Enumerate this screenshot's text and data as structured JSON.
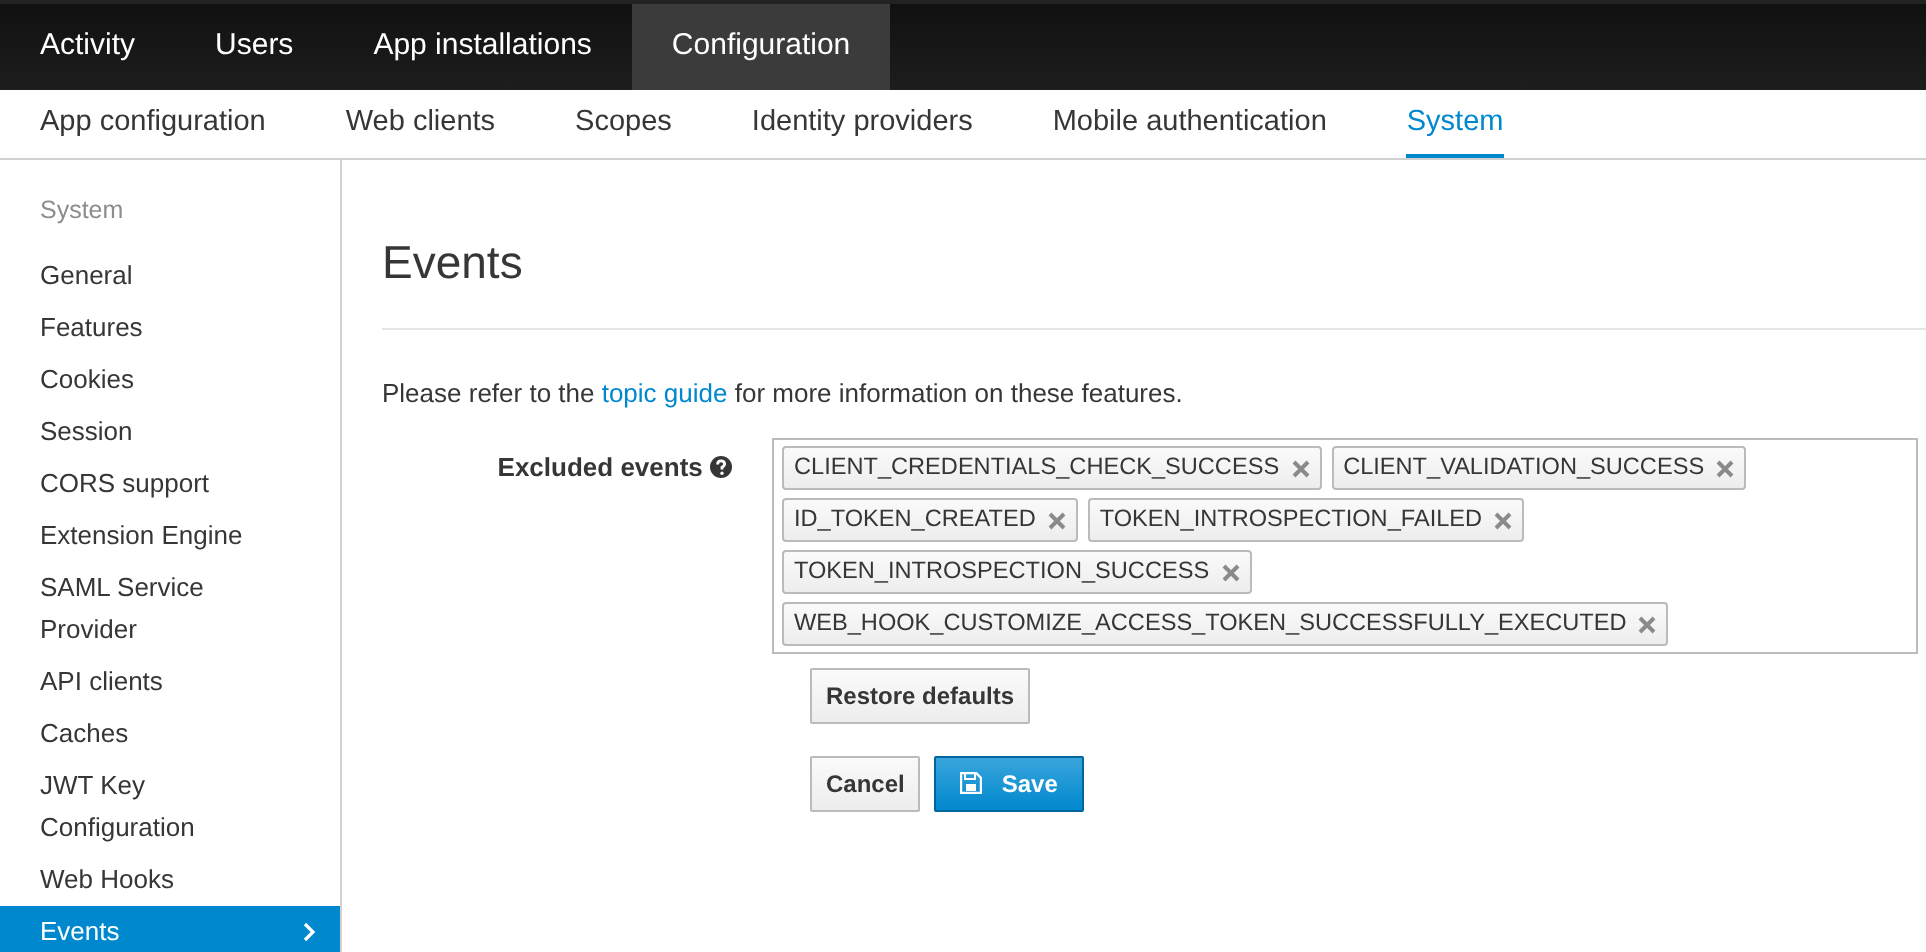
{
  "top_nav": [
    {
      "label": "Activity",
      "selected": false
    },
    {
      "label": "Users",
      "selected": false
    },
    {
      "label": "App installations",
      "selected": false
    },
    {
      "label": "Configuration",
      "selected": true
    }
  ],
  "sub_nav": [
    {
      "label": "App configuration",
      "selected": false
    },
    {
      "label": "Web clients",
      "selected": false
    },
    {
      "label": "Scopes",
      "selected": false
    },
    {
      "label": "Identity providers",
      "selected": false
    },
    {
      "label": "Mobile authentication",
      "selected": false
    },
    {
      "label": "System",
      "selected": true
    }
  ],
  "sidebar": {
    "heading": "System",
    "items": [
      {
        "label": "General",
        "selected": false
      },
      {
        "label": "Features",
        "selected": false
      },
      {
        "label": "Cookies",
        "selected": false
      },
      {
        "label": "Session",
        "selected": false
      },
      {
        "label": "CORS support",
        "selected": false
      },
      {
        "label": "Extension Engine",
        "selected": false
      },
      {
        "label": "SAML Service Provider",
        "selected": false
      },
      {
        "label": "API clients",
        "selected": false
      },
      {
        "label": "Caches",
        "selected": false
      },
      {
        "label": "JWT Key Configuration",
        "selected": false
      },
      {
        "label": "Web Hooks",
        "selected": false
      },
      {
        "label": "Events",
        "selected": true
      }
    ]
  },
  "page_title": "Events",
  "intro": {
    "before": "Please refer to the ",
    "link": "topic guide",
    "after": " for more information on these features."
  },
  "excluded_events": {
    "label": "Excluded events",
    "tags": [
      "CLIENT_CREDENTIALS_CHECK_SUCCESS",
      "CLIENT_VALIDATION_SUCCESS",
      "ID_TOKEN_CREATED",
      "TOKEN_INTROSPECTION_FAILED",
      "TOKEN_INTROSPECTION_SUCCESS",
      "WEB_HOOK_CUSTOMIZE_ACCESS_TOKEN_SUCCESSFULLY_EXECUTED"
    ]
  },
  "restore_button": "Restore defaults",
  "buttons": [
    {
      "label": "Cancel",
      "kind": "default"
    },
    {
      "label": "Save",
      "kind": "primary"
    }
  ]
}
